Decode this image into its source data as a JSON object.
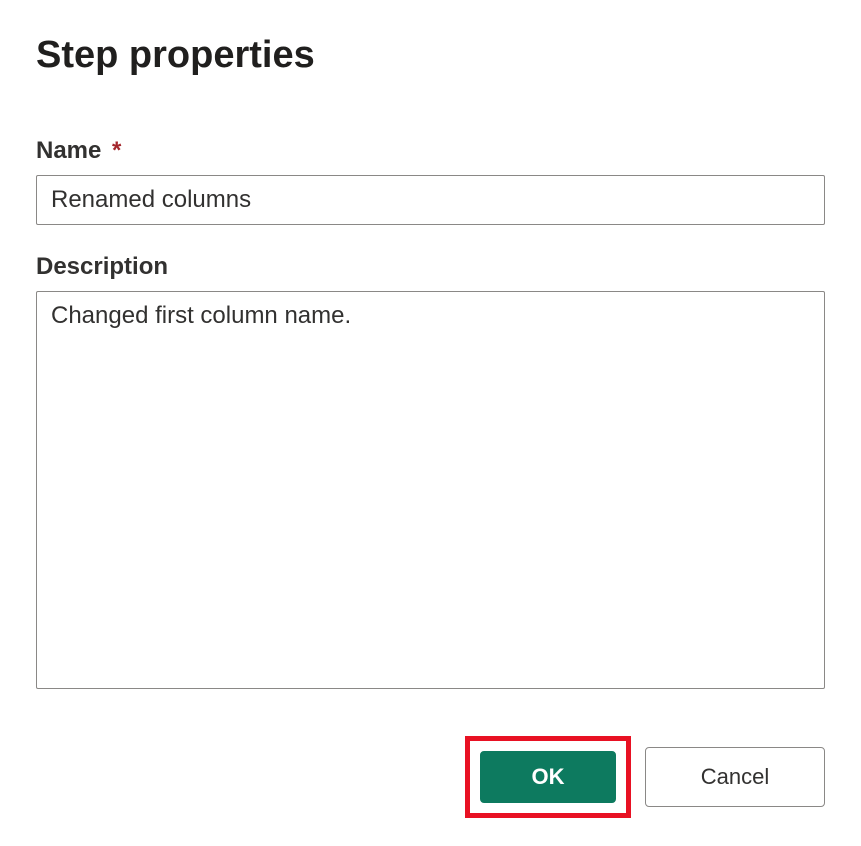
{
  "dialog": {
    "title": "Step properties",
    "name_label": "Name",
    "name_required_marker": "*",
    "name_value": "Renamed columns",
    "description_label": "Description",
    "description_value": "Changed first column name."
  },
  "buttons": {
    "ok_label": "OK",
    "cancel_label": "Cancel"
  }
}
